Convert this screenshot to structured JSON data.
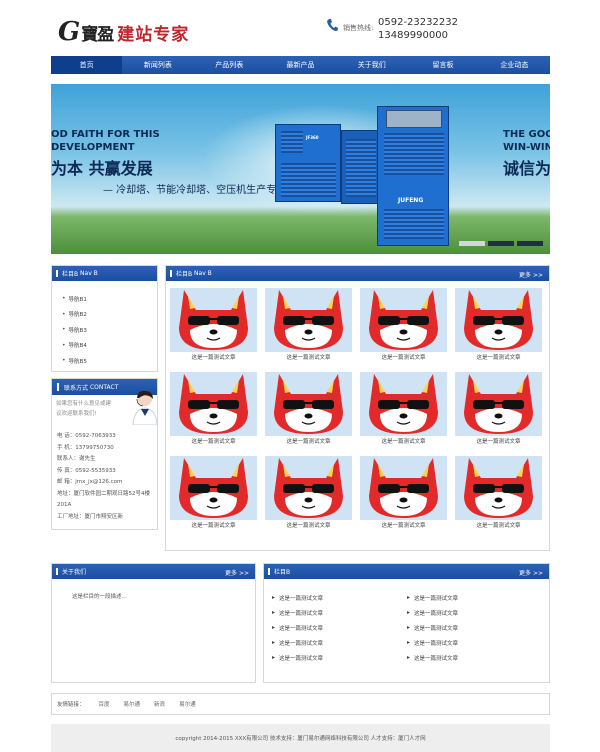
{
  "header": {
    "logo_g": "G",
    "logo_brand": "寶盈",
    "logo_text": "建站专家",
    "hotline_label": "销售热线:",
    "hotline_1": "0592-23232232",
    "hotline_2": "13489990000"
  },
  "nav": {
    "items": [
      "首页",
      "新闻列表",
      "产品列表",
      "最新产品",
      "关于我们",
      "留言板",
      "企业动态"
    ]
  },
  "banner": {
    "left_en_1": "OD FAITH FOR THIS",
    "left_en_2": "DEVELOPMENT",
    "left_cn": "为本 共赢发展",
    "subtitle": "— 冷却塔、节能冷却塔、空压机生产专家",
    "right_en_1": "THE GOO",
    "right_en_2": "WIN-WIN",
    "right_cn": "诚信为",
    "machine_brand": "JUFENG",
    "slides": 3,
    "active_slide": 0
  },
  "sidebar": {
    "title": "栏目B",
    "title_en": "Nav B",
    "items": [
      "导航B1",
      "导航B2",
      "导航B3",
      "导航B4",
      "导航B5"
    ]
  },
  "contact": {
    "title": "联系方式",
    "title_en": "CONTACT",
    "intro": "如果您有什么意见或建议欢迎联系我们!",
    "lines": [
      "电 话：0592-7063933",
      "手 机：13799750730",
      "联系人：谢先生",
      "传 真：0592-5535933",
      "邮 箱：jmx_jx@126.com",
      "地址：厦门软件园二期观日路52号4楼201A",
      "工厂地址：厦门市翔安区新"
    ]
  },
  "products": {
    "title": "栏目B",
    "title_en": "Nav B",
    "more": "更多 >>",
    "caption": "这是一篇测试文章",
    "count": 12
  },
  "about": {
    "title": "关于我们",
    "more": "更多 >>",
    "text": "这是栏目的一段描述..."
  },
  "colb": {
    "title": "栏目B",
    "more": "更多 >>",
    "items": [
      "这是一篇测试文章",
      "这是一篇测试文章",
      "这是一篇测试文章",
      "这是一篇测试文章",
      "这是一篇测试文章",
      "这是一篇测试文章",
      "这是一篇测试文章",
      "这是一篇测试文章",
      "这是一篇测试文章",
      "这是一篇测试文章"
    ]
  },
  "links": {
    "label": "友情链接：",
    "items": [
      "百度",
      "易尔通",
      "新浪",
      "易尔通"
    ]
  },
  "footer": {
    "text": "copyright 2014-2015 XXX有限公司  技术支持：厦门易尔通网络科技有限公司  人才支持：厦门人才网"
  },
  "colors": {
    "brand_blue": "#1b4ea0",
    "logo_red": "#c0262d",
    "mascot_red": "#e22a2a"
  }
}
